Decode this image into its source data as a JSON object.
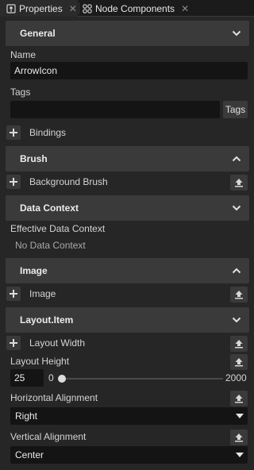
{
  "tabs": [
    {
      "label": "Properties",
      "icon": "properties-icon",
      "active": true
    },
    {
      "label": "Node Components",
      "icon": "node-components-icon",
      "active": false
    }
  ],
  "sections": {
    "general": {
      "title": "General",
      "name_label": "Name",
      "name_value": "ArrowIcon",
      "tags_label": "Tags",
      "tags_value": "",
      "tags_button": "Tags",
      "bindings_label": "Bindings"
    },
    "brush": {
      "title": "Brush",
      "background_brush_label": "Background Brush"
    },
    "data_context": {
      "title": "Data Context",
      "effective_label": "Effective Data Context",
      "effective_value": "No Data Context"
    },
    "image": {
      "title": "Image",
      "image_label": "Image"
    },
    "layout_item": {
      "title": "Layout.Item",
      "layout_width_label": "Layout Width",
      "layout_height_label": "Layout Height",
      "layout_height_value": "25",
      "slider_min": "0",
      "slider_max": "2000",
      "slider_value": 0,
      "horizontal_alignment_label": "Horizontal Alignment",
      "horizontal_alignment_value": "Right",
      "vertical_alignment_label": "Vertical Alignment",
      "vertical_alignment_value": "Center"
    }
  }
}
